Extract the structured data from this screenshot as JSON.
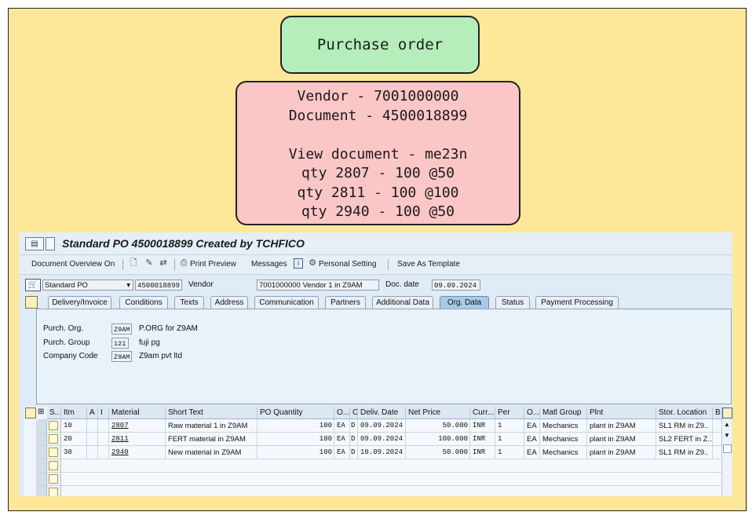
{
  "notes": {
    "purchase_order": "Purchase order",
    "details": [
      "Vendor - 7001000000",
      "Document - 4500018899",
      "",
      "View document - me23n",
      "qty 2807 - 100 @50",
      "qty 2811 - 100 @100",
      "qty 2940 - 100 @50"
    ]
  },
  "window": {
    "title": "Standard PO 4500018899 Created by TCHFICO"
  },
  "toolbar": {
    "document_overview": "Document Overview On",
    "print_preview": "Print Preview",
    "messages": "Messages",
    "personal_setting": "Personal Setting",
    "save_as_template": "Save As Template"
  },
  "header": {
    "doc_type": "Standard PO",
    "po_number": "4500018899",
    "vendor_label": "Vendor",
    "vendor_value": "7001000000 Vendor 1 in Z9AM",
    "doc_date_label": "Doc. date",
    "doc_date_value": "09.09.2024"
  },
  "tabs": [
    "Delivery/Invoice",
    "Conditions",
    "Texts",
    "Address",
    "Communication",
    "Partners",
    "Additional Data",
    "Org. Data",
    "Status",
    "Payment Processing"
  ],
  "active_tab": "Org. Data",
  "org_data": {
    "purch_org_label": "Purch. Org.",
    "purch_org_code": "Z9AM",
    "purch_org_desc": "P.ORG for Z9AM",
    "purch_group_label": "Purch. Group",
    "purch_group_code": "121",
    "purch_group_desc": "fuji pg",
    "company_code_label": "Company Code",
    "company_code_code": "Z9AM",
    "company_code_desc": "Z9am pvt ltd"
  },
  "items_table": {
    "columns": [
      "S..",
      "Itm",
      "A",
      "I",
      "Material",
      "Short Text",
      "PO Quantity",
      "O...",
      "C",
      "Deliv. Date",
      "Net Price",
      "Curr...",
      "Per",
      "O...",
      "Matl Group",
      "Plnt",
      "Stor. Location",
      "B"
    ],
    "rows": [
      {
        "itm": "10",
        "material": "2807",
        "short_text": "Raw material 1 in Z9AM",
        "qty": "100",
        "uom": "EA",
        "c": "D",
        "deliv_date": "09.09.2024",
        "net_price": "50.000",
        "curr": "INR",
        "per": "1",
        "o": "EA",
        "matl_group": "Mechanics",
        "plnt": "plant in Z9AM",
        "stor_loc": "SL1  RM in Z9.."
      },
      {
        "itm": "20",
        "material": "2811",
        "short_text": "FERT material in Z9AM",
        "qty": "100",
        "uom": "EA",
        "c": "D",
        "deliv_date": "09.09.2024",
        "net_price": "100.000",
        "curr": "INR",
        "per": "1",
        "o": "EA",
        "matl_group": "Mechanics",
        "plnt": "plant in Z9AM",
        "stor_loc": "SL2 FERT in Z.."
      },
      {
        "itm": "30",
        "material": "2940",
        "short_text": "New material in Z9AM",
        "qty": "100",
        "uom": "EA",
        "c": "D",
        "deliv_date": "10.09.2024",
        "net_price": "50.000",
        "curr": "INR",
        "per": "1",
        "o": "EA",
        "matl_group": "Mechanics",
        "plnt": "plant in Z9AM",
        "stor_loc": "SL1  RM in Z9.."
      }
    ]
  }
}
